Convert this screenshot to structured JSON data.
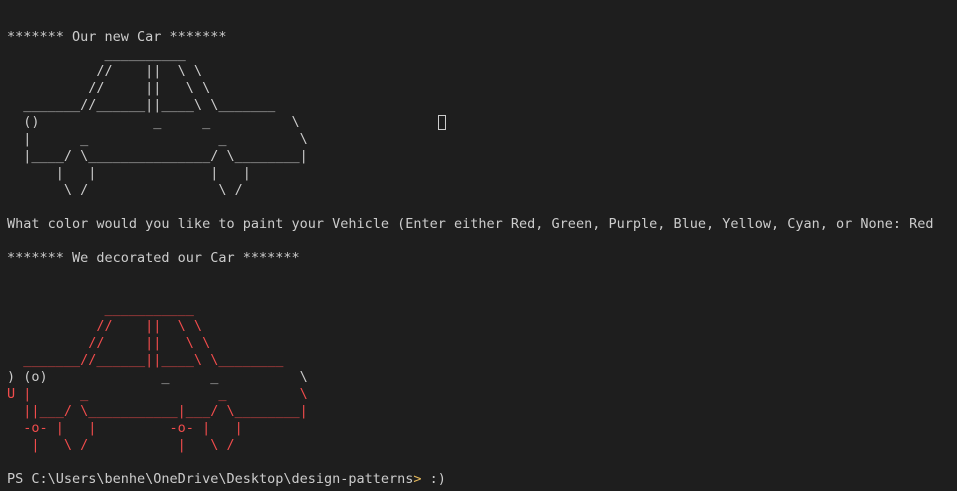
{
  "terminal": {
    "heading_new": "******* Our new Car *******",
    "car_plain": [
      "            __________",
      "           //    ||  \\ \\",
      "          //     ||   \\ \\",
      "  _______//______||____\\ \\_______",
      "  ()              _     _          \\",
      "  |      _                _         \\",
      "  |____/ \\_______________/ \\________|",
      "      |   |              |   |",
      "       \\ /                \\ /"
    ],
    "question": "What color would you like to paint your Vehicle (Enter either Red, Green, Purple, Blue, Yellow, Cyan, or None: Red",
    "heading_decorated": "******* We decorated our Car *******",
    "car_decorated": [
      {
        "segments": [
          {
            "text": "            ___________",
            "color": "red"
          }
        ]
      },
      {
        "segments": [
          {
            "text": "           //    ||  \\ \\",
            "color": "red"
          }
        ]
      },
      {
        "segments": [
          {
            "text": "          //     ||   \\ \\",
            "color": "red"
          }
        ]
      },
      {
        "segments": [
          {
            "text": "  _______//______||____\\ \\________",
            "color": "red"
          }
        ]
      },
      {
        "segments": [
          {
            "text": ") (o)",
            "color": "white"
          },
          {
            "text": "              _     _          \\",
            "color": "white"
          }
        ]
      },
      {
        "segments": [
          {
            "text": "U |      _                _         \\",
            "color": "red"
          }
        ]
      },
      {
        "segments": [
          {
            "text": "  ||___/ \\___________|___/ \\________|",
            "color": "red"
          }
        ]
      },
      {
        "segments": [
          {
            "text": "  -o- |   |         -o- |   |",
            "color": "red"
          }
        ]
      },
      {
        "segments": [
          {
            "text": "   |   \\ /           |   \\ /",
            "color": "red"
          }
        ]
      }
    ],
    "prompt_path": "PS C:\\Users\\benhe\\OneDrive\\Desktop\\design-patterns",
    "prompt_arrow": ">",
    "prompt_input": " :)"
  }
}
